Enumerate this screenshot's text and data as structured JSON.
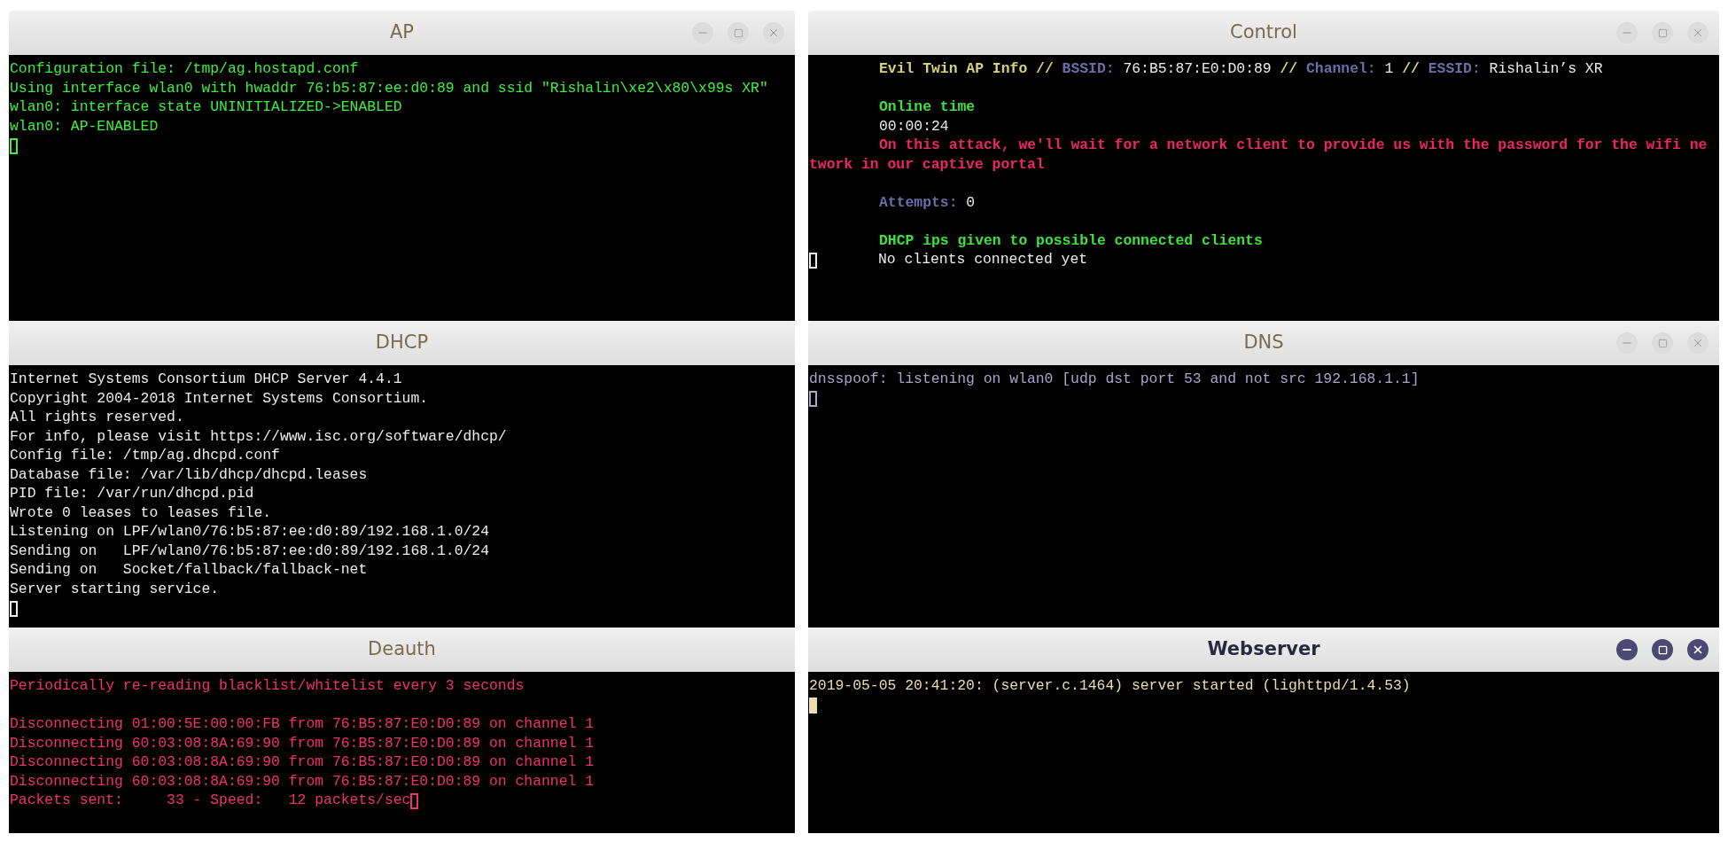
{
  "columns": [
    {
      "windows": [
        {
          "title": "AP",
          "active": false,
          "controls_visible": true,
          "color": "#3ef03e",
          "lines": [
            {
              "kind": "text",
              "segments": [
                {
                  "kind": "plain",
                  "text": "Configuration file: /tmp/ag.hostapd.conf"
                }
              ]
            },
            {
              "kind": "text",
              "segments": [
                {
                  "kind": "plain",
                  "text": "Using interface wlan0 with hwaddr 76:b5:87:ee:d0:89 and ssid \"Rishalin\\xe2\\x80\\x99s XR\""
                }
              ]
            },
            {
              "kind": "text",
              "segments": [
                {
                  "kind": "plain",
                  "text": "wlan0: interface state UNINITIALIZED->ENABLED"
                }
              ]
            },
            {
              "kind": "text",
              "segments": [
                {
                  "kind": "plain",
                  "text": "wlan0: AP-ENABLED"
                }
              ]
            },
            {
              "kind": "text",
              "segments": [
                {
                  "kind": "cursor_outline"
                }
              ]
            }
          ]
        },
        {
          "title": "DHCP",
          "active": false,
          "controls_visible": false,
          "color": "#ececec",
          "lines": [
            {
              "kind": "text",
              "segments": [
                {
                  "kind": "plain",
                  "text": "Internet Systems Consortium DHCP Server 4.4.1"
                }
              ]
            },
            {
              "kind": "text",
              "segments": [
                {
                  "kind": "plain",
                  "text": "Copyright 2004-2018 Internet Systems Consortium."
                }
              ]
            },
            {
              "kind": "text",
              "segments": [
                {
                  "kind": "plain",
                  "text": "All rights reserved."
                }
              ]
            },
            {
              "kind": "text",
              "segments": [
                {
                  "kind": "plain",
                  "text": "For info, please visit https://www.isc.org/software/dhcp/"
                }
              ]
            },
            {
              "kind": "text",
              "segments": [
                {
                  "kind": "plain",
                  "text": "Config file: /tmp/ag.dhcpd.conf"
                }
              ]
            },
            {
              "kind": "text",
              "segments": [
                {
                  "kind": "plain",
                  "text": "Database file: /var/lib/dhcp/dhcpd.leases"
                }
              ]
            },
            {
              "kind": "text",
              "segments": [
                {
                  "kind": "plain",
                  "text": "PID file: /var/run/dhcpd.pid"
                }
              ]
            },
            {
              "kind": "text",
              "segments": [
                {
                  "kind": "plain",
                  "text": "Wrote 0 leases to leases file."
                }
              ]
            },
            {
              "kind": "text",
              "segments": [
                {
                  "kind": "plain",
                  "text": "Listening on LPF/wlan0/76:b5:87:ee:d0:89/192.168.1.0/24"
                }
              ]
            },
            {
              "kind": "text",
              "segments": [
                {
                  "kind": "plain",
                  "text": "Sending on   LPF/wlan0/76:b5:87:ee:d0:89/192.168.1.0/24"
                }
              ]
            },
            {
              "kind": "text",
              "segments": [
                {
                  "kind": "plain",
                  "text": "Sending on   Socket/fallback/fallback-net"
                }
              ]
            },
            {
              "kind": "text",
              "segments": [
                {
                  "kind": "plain",
                  "text": "Server starting service."
                }
              ]
            },
            {
              "kind": "text",
              "segments": [
                {
                  "kind": "cursor_outline"
                }
              ]
            }
          ]
        },
        {
          "title": "Deauth",
          "active": false,
          "controls_visible": false,
          "color": "#f2306c",
          "lines": [
            {
              "kind": "text",
              "segments": [
                {
                  "kind": "plain",
                  "text": "Periodically re-reading blacklist/whitelist every 3 seconds"
                }
              ]
            },
            {
              "kind": "blank"
            },
            {
              "kind": "text",
              "segments": [
                {
                  "kind": "plain",
                  "text": "Disconnecting 01:00:5E:00:00:FB from 76:B5:87:E0:D0:89 on channel 1"
                }
              ]
            },
            {
              "kind": "text",
              "segments": [
                {
                  "kind": "plain",
                  "text": "Disconnecting 60:03:08:8A:69:90 from 76:B5:87:E0:D0:89 on channel 1"
                }
              ]
            },
            {
              "kind": "text",
              "segments": [
                {
                  "kind": "plain",
                  "text": "Disconnecting 60:03:08:8A:69:90 from 76:B5:87:E0:D0:89 on channel 1"
                }
              ]
            },
            {
              "kind": "text",
              "segments": [
                {
                  "kind": "plain",
                  "text": "Disconnecting 60:03:08:8A:69:90 from 76:B5:87:E0:D0:89 on channel 1"
                }
              ]
            },
            {
              "kind": "text",
              "segments": [
                {
                  "kind": "plain",
                  "text": "Packets sent:     33 - Speed:   12 packets/sec"
                },
                {
                  "kind": "cursor_outline"
                }
              ]
            }
          ]
        }
      ]
    },
    {
      "windows": [
        {
          "title": "Control",
          "active": false,
          "controls_visible": true,
          "color": "#ececec",
          "lines": [
            {
              "kind": "indented",
              "segments": [
                {
                  "kind": "heading",
                  "text": "Evil Twin AP Info //"
                },
                {
                  "kind": "label",
                  "text": " BSSID:"
                },
                {
                  "kind": "plain",
                  "text": " 76:B5:87:E0:D0:89 "
                },
                {
                  "kind": "heading",
                  "text": "//"
                },
                {
                  "kind": "label",
                  "text": " Channel:"
                },
                {
                  "kind": "plain",
                  "text": " 1 "
                },
                {
                  "kind": "heading",
                  "text": "//"
                },
                {
                  "kind": "label",
                  "text": " ESSID:"
                },
                {
                  "kind": "plain",
                  "text": " Rishalin’s XR"
                }
              ]
            },
            {
              "kind": "blank"
            },
            {
              "kind": "indented",
              "segments": [
                {
                  "kind": "ok",
                  "text": "Online time"
                }
              ]
            },
            {
              "kind": "indented",
              "segments": [
                {
                  "kind": "plain",
                  "text": "00:00:24"
                }
              ]
            },
            {
              "kind": "indented",
              "segments": [
                {
                  "kind": "alert",
                  "text": "On this attack, we'll wait for a network client to provide us with the password for the wifi ne"
                }
              ]
            },
            {
              "kind": "text",
              "segments": [
                {
                  "kind": "alert",
                  "text": "twork in our captive portal"
                }
              ]
            },
            {
              "kind": "blank"
            },
            {
              "kind": "indented",
              "segments": [
                {
                  "kind": "label",
                  "text": "Attempts:"
                },
                {
                  "kind": "plain",
                  "text": " 0"
                }
              ]
            },
            {
              "kind": "blank"
            },
            {
              "kind": "indented",
              "segments": [
                {
                  "kind": "ok",
                  "text": "DHCP ips given to possible connected clients"
                }
              ]
            },
            {
              "kind": "text",
              "segments": [
                {
                  "kind": "cursor_outline"
                },
                {
                  "kind": "tab"
                },
                {
                  "kind": "plain",
                  "text": "No clients connected yet"
                }
              ]
            }
          ]
        },
        {
          "title": "DNS",
          "active": false,
          "controls_visible": true,
          "color": "#a9a4cc",
          "lines": [
            {
              "kind": "text",
              "segments": [
                {
                  "kind": "plain",
                  "text": "dnsspoof: listening on wlan0 [udp dst port 53 and not src 192.168.1.1]"
                }
              ]
            },
            {
              "kind": "text",
              "segments": [
                {
                  "kind": "cursor_outline"
                }
              ]
            }
          ]
        },
        {
          "title": "Webserver",
          "active": true,
          "controls_visible": true,
          "color": "#ecdcae",
          "lines": [
            {
              "kind": "text",
              "segments": [
                {
                  "kind": "plain",
                  "text": "2019-05-05 20:41:20: (server.c.1464) server started (lighttpd/1.4.53)"
                }
              ]
            },
            {
              "kind": "text",
              "segments": [
                {
                  "kind": "cursor_filled"
                }
              ]
            }
          ]
        }
      ]
    }
  ]
}
